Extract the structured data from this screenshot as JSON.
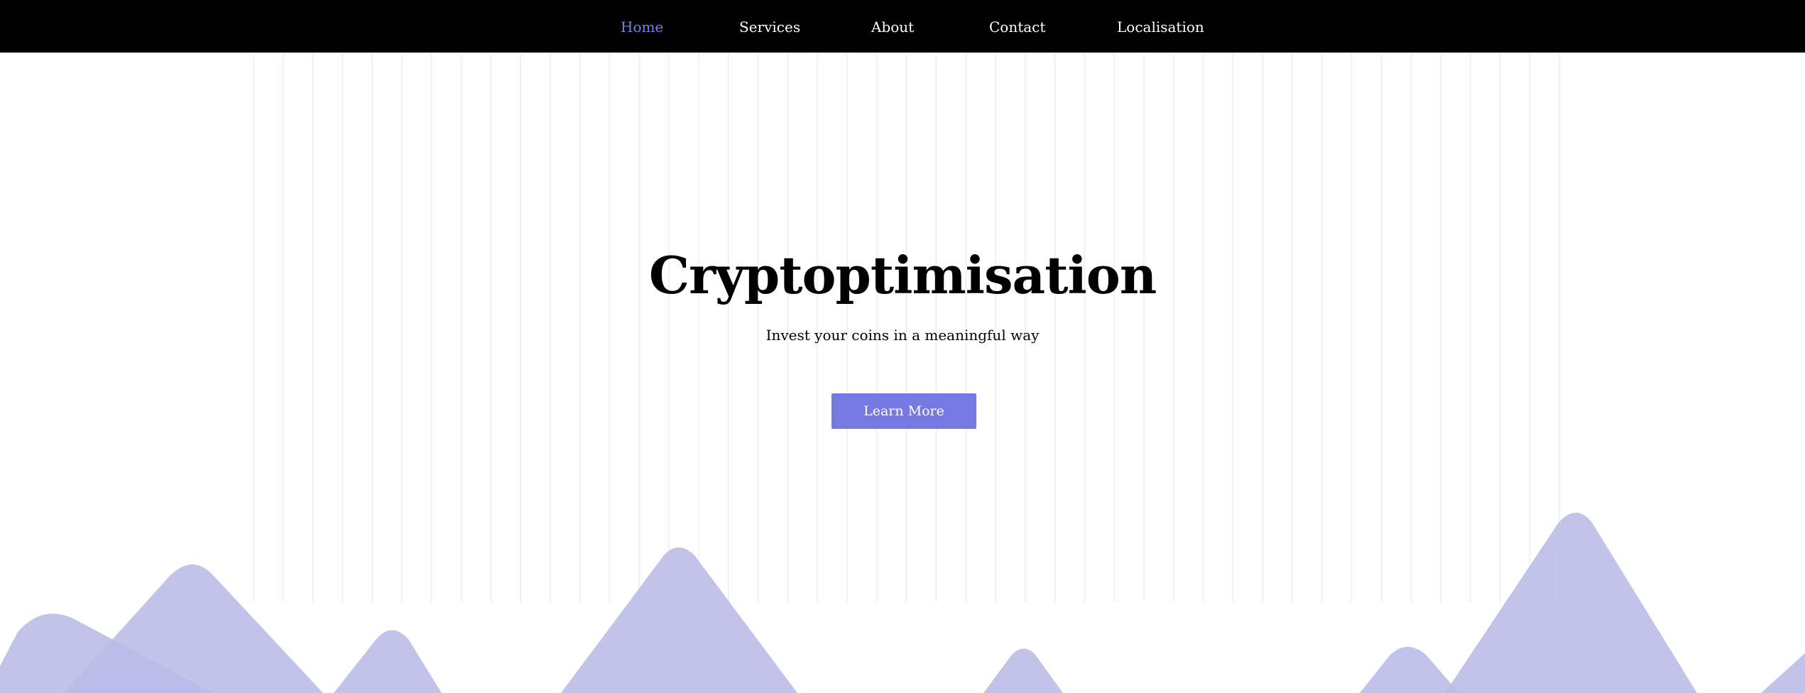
{
  "nav": {
    "items": [
      {
        "label": "Home",
        "active": true
      },
      {
        "label": "Services",
        "active": false
      },
      {
        "label": "About",
        "active": false
      },
      {
        "label": "Contact",
        "active": false
      },
      {
        "label": "Localisation",
        "active": false
      }
    ]
  },
  "hero": {
    "title": "Cryptoptimisation",
    "subtitle": "Invest your coins in a meaningful way",
    "cta_label": "Learn More"
  },
  "colors": {
    "nav_background": "#000000",
    "nav_active": "#7b7fe8",
    "accent": "#7779e2",
    "mountain": "#b9bbe6",
    "grid_line": "#eeeef2"
  }
}
